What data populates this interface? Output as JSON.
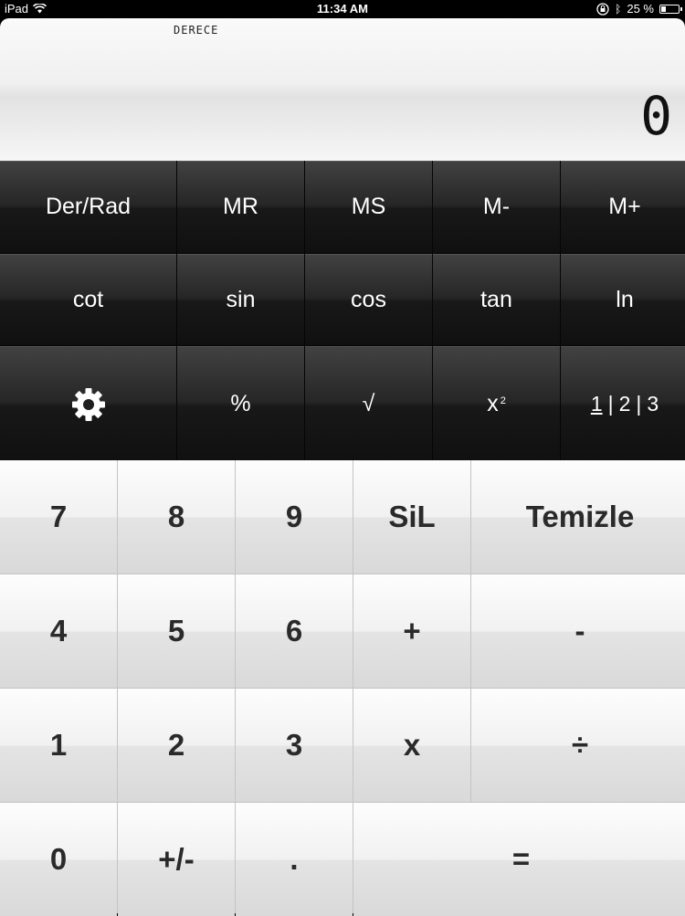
{
  "status_bar": {
    "device": "iPad",
    "time": "11:34 AM",
    "battery": "25 %"
  },
  "display": {
    "mode": "DERECE",
    "value": "0"
  },
  "function_rows": [
    [
      "Der/Rad",
      "MR",
      "MS",
      "M-",
      "M+"
    ],
    [
      "cot",
      "sin",
      "cos",
      "tan",
      "ln"
    ]
  ],
  "row3": {
    "settings_icon": "gear-icon",
    "percent": "%",
    "sqrt": "√",
    "square_base": "x",
    "square_exp": "2",
    "page_1": "1",
    "page_2": "2",
    "page_3": "3"
  },
  "keypad": {
    "k7": "7",
    "k8": "8",
    "k9": "9",
    "sil": "SiL",
    "clear": "Temizle",
    "k4": "4",
    "k5": "5",
    "k6": "6",
    "plus": "+",
    "minus": "-",
    "k1": "1",
    "k2": "2",
    "k3": "3",
    "times": "x",
    "divide": "÷",
    "k0": "0",
    "sign": "+/-",
    "dot": ".",
    "equals": "="
  }
}
